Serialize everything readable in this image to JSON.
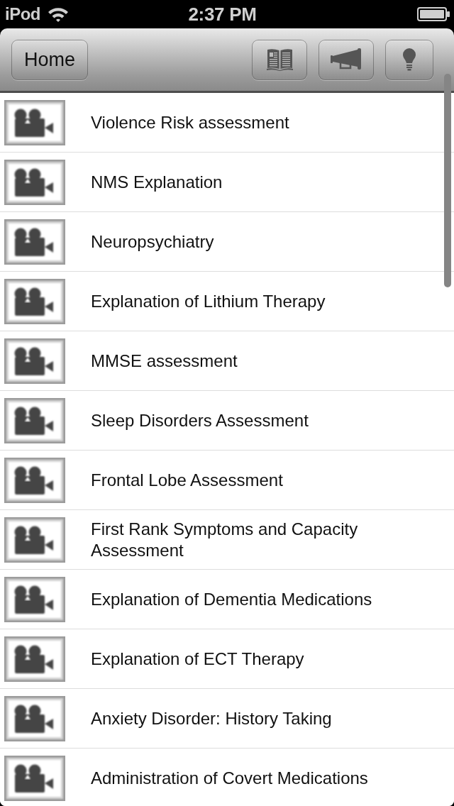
{
  "status_bar": {
    "carrier": "iPod",
    "time": "2:37 PM"
  },
  "nav_bar": {
    "home_button": "Home",
    "icon_buttons": [
      {
        "kind": "book"
      },
      {
        "kind": "megaphone"
      },
      {
        "kind": "lightbulb"
      }
    ]
  },
  "videos": [
    {
      "title": "Violence Risk assessment"
    },
    {
      "title": "NMS Explanation"
    },
    {
      "title": "Neuropsychiatry"
    },
    {
      "title": "Explanation of Lithium Therapy"
    },
    {
      "title": "MMSE assessment"
    },
    {
      "title": "Sleep Disorders Assessment"
    },
    {
      "title": "Frontal Lobe Assessment"
    },
    {
      "title": "First Rank Symptoms and Capacity Assessment"
    },
    {
      "title": "Explanation of Dementia Medications"
    },
    {
      "title": "Explanation of ECT Therapy"
    },
    {
      "title": "Anxiety Disorder: History Taking"
    },
    {
      "title": "Administration of Covert Medications"
    }
  ]
}
